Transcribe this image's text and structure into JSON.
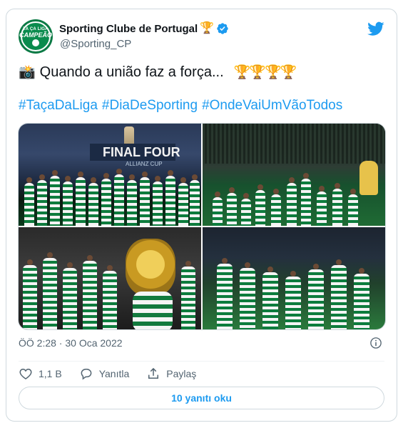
{
  "tweet": {
    "author": {
      "display_name": "Sporting Clube de Portugal",
      "handle": "@Sporting_CP",
      "name_emoji": "🏆",
      "avatar_text_top": "TA ÇA LIGA",
      "avatar_text_main": "CAMPEÃO",
      "verified": true
    },
    "brand_icon": "twitter-bird-icon",
    "text": {
      "emoji_prefix": "📸",
      "body": "Quando a união faz a força...",
      "emoji_suffix": "🏆🏆🏆🏆"
    },
    "hashtags": [
      "#TaçaDaLiga",
      "#DiaDeSporting",
      "#OndeVaiUmVãoTodos"
    ],
    "media": {
      "photo_1_banner": "FINAL FOUR",
      "photo_1_sub": "ALLIANZ CUP"
    },
    "timestamp": "ÖÖ 2:28 · 30 Oca 2022",
    "actions": {
      "like_count": "1,1 B",
      "reply_label": "Yanıtla",
      "share_label": "Paylaş"
    },
    "replies_button": "10 yanıtı oku"
  },
  "colors": {
    "accent": "#1d9bf0",
    "text_secondary": "#536471",
    "sporting_green": "#0b7a45"
  }
}
